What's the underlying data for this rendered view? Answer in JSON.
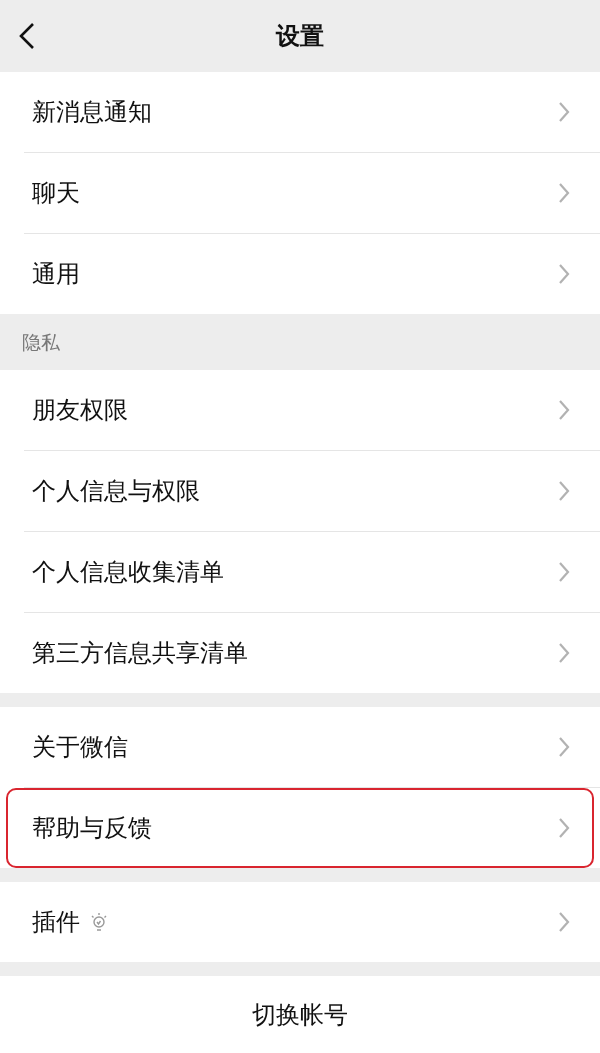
{
  "header": {
    "title": "设置"
  },
  "sections": [
    {
      "items": [
        {
          "label": "新消息通知",
          "highlighted": false,
          "bulb": false
        },
        {
          "label": "聊天",
          "highlighted": false,
          "bulb": false
        },
        {
          "label": "通用",
          "highlighted": false,
          "bulb": false
        }
      ]
    },
    {
      "heading": "隐私",
      "items": [
        {
          "label": "朋友权限",
          "highlighted": false,
          "bulb": false
        },
        {
          "label": "个人信息与权限",
          "highlighted": false,
          "bulb": false
        },
        {
          "label": "个人信息收集清单",
          "highlighted": false,
          "bulb": false
        },
        {
          "label": "第三方信息共享清单",
          "highlighted": false,
          "bulb": false
        }
      ]
    },
    {
      "items": [
        {
          "label": "关于微信",
          "highlighted": false,
          "bulb": false
        },
        {
          "label": "帮助与反馈",
          "highlighted": true,
          "bulb": false
        }
      ]
    },
    {
      "items": [
        {
          "label": "插件",
          "highlighted": false,
          "bulb": true
        }
      ]
    }
  ],
  "switch_account": "切换帐号"
}
